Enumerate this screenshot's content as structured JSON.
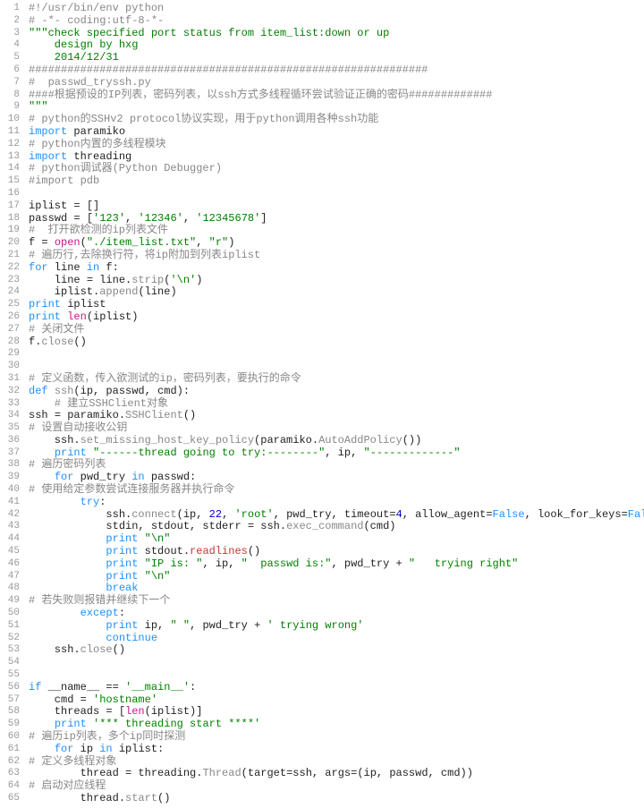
{
  "lines": [
    {
      "n": 1,
      "seg": [
        [
          "c",
          "#!/usr/bin/env python"
        ]
      ]
    },
    {
      "n": 2,
      "seg": [
        [
          "c",
          "# -*- coding:utf-8-*-"
        ]
      ]
    },
    {
      "n": 3,
      "seg": [
        [
          "s",
          "\"\"\"check specified port status from item_list:down or up"
        ]
      ]
    },
    {
      "n": 4,
      "seg": [
        [
          "s",
          "    design by hxg"
        ]
      ]
    },
    {
      "n": 5,
      "seg": [
        [
          "s",
          "    2014/12/31"
        ]
      ]
    },
    {
      "n": 6,
      "seg": [
        [
          "c",
          "##############################################################"
        ]
      ]
    },
    {
      "n": 7,
      "seg": [
        [
          "c",
          "#  passwd_tryssh.py"
        ]
      ]
    },
    {
      "n": 8,
      "seg": [
        [
          "c",
          "####根据预设的IP列表，密码列表，以ssh方式多线程循环尝试验证正确的密码#############"
        ]
      ]
    },
    {
      "n": 9,
      "seg": [
        [
          "s",
          "\"\"\""
        ]
      ]
    },
    {
      "n": 10,
      "seg": [
        [
          "c",
          "# python的SSHv2 protocol协议实现，用于python调用各种ssh功能"
        ]
      ]
    },
    {
      "n": 11,
      "seg": [
        [
          "kw",
          "import"
        ],
        [
          "nm",
          " paramiko"
        ]
      ]
    },
    {
      "n": 12,
      "seg": [
        [
          "c",
          "# python内置的多线程模块"
        ]
      ]
    },
    {
      "n": 13,
      "seg": [
        [
          "kw",
          "import"
        ],
        [
          "nm",
          " threading"
        ]
      ]
    },
    {
      "n": 14,
      "seg": [
        [
          "c",
          "# python调试器(Python Debugger)"
        ]
      ]
    },
    {
      "n": 15,
      "seg": [
        [
          "c",
          "#import pdb"
        ]
      ]
    },
    {
      "n": 16,
      "seg": [
        [
          "nm",
          ""
        ]
      ]
    },
    {
      "n": 17,
      "seg": [
        [
          "nm",
          "iplist "
        ],
        [
          "op",
          "="
        ],
        [
          "nm",
          " []"
        ]
      ]
    },
    {
      "n": 18,
      "seg": [
        [
          "nm",
          "passwd "
        ],
        [
          "op",
          "="
        ],
        [
          "nm",
          " ["
        ],
        [
          "s",
          "'123'"
        ],
        [
          "nm",
          ", "
        ],
        [
          "s",
          "'12346'"
        ],
        [
          "nm",
          ", "
        ],
        [
          "s",
          "'12345678'"
        ],
        [
          "nm",
          "]"
        ]
      ]
    },
    {
      "n": 19,
      "seg": [
        [
          "c",
          "#  打开欲检测的ip列表文件"
        ]
      ]
    },
    {
      "n": 20,
      "seg": [
        [
          "nm",
          "f "
        ],
        [
          "op",
          "="
        ],
        [
          "nm",
          " "
        ],
        [
          "bi",
          "open"
        ],
        [
          "nm",
          "("
        ],
        [
          "s",
          "\"./item_list.txt\""
        ],
        [
          "nm",
          ", "
        ],
        [
          "s",
          "\"r\""
        ],
        [
          "nm",
          ")"
        ]
      ]
    },
    {
      "n": 21,
      "seg": [
        [
          "c",
          "# 遍历行,去除换行符，将ip附加到列表iplist"
        ]
      ]
    },
    {
      "n": 22,
      "seg": [
        [
          "kw",
          "for"
        ],
        [
          "nm",
          " line "
        ],
        [
          "kw",
          "in"
        ],
        [
          "nm",
          " f:"
        ]
      ]
    },
    {
      "n": 23,
      "seg": [
        [
          "nm",
          "    line "
        ],
        [
          "op",
          "="
        ],
        [
          "nm",
          " line."
        ],
        [
          "fn",
          "strip"
        ],
        [
          "nm",
          "("
        ],
        [
          "s",
          "'\\n'"
        ],
        [
          "nm",
          ")"
        ]
      ]
    },
    {
      "n": 24,
      "seg": [
        [
          "nm",
          "    iplist."
        ],
        [
          "fn",
          "append"
        ],
        [
          "nm",
          "(line)"
        ]
      ]
    },
    {
      "n": 25,
      "seg": [
        [
          "kw",
          "print"
        ],
        [
          "nm",
          " iplist"
        ]
      ]
    },
    {
      "n": 26,
      "seg": [
        [
          "kw",
          "print"
        ],
        [
          "nm",
          " "
        ],
        [
          "bi",
          "len"
        ],
        [
          "nm",
          "(iplist)"
        ]
      ]
    },
    {
      "n": 27,
      "seg": [
        [
          "c",
          "# 关闭文件"
        ]
      ]
    },
    {
      "n": 28,
      "seg": [
        [
          "nm",
          "f."
        ],
        [
          "fn",
          "close"
        ],
        [
          "nm",
          "()"
        ]
      ]
    },
    {
      "n": 29,
      "seg": [
        [
          "nm",
          ""
        ]
      ]
    },
    {
      "n": 30,
      "seg": [
        [
          "nm",
          ""
        ]
      ]
    },
    {
      "n": 31,
      "seg": [
        [
          "c",
          "# 定义函数，传入欲测试的ip，密码列表，要执行的命令"
        ]
      ]
    },
    {
      "n": 32,
      "seg": [
        [
          "kw",
          "def"
        ],
        [
          "nm",
          " "
        ],
        [
          "fn",
          "ssh"
        ],
        [
          "nm",
          "(ip, passwd, cmd):"
        ]
      ]
    },
    {
      "n": 33,
      "seg": [
        [
          "c",
          "    # 建立SSHClient对象"
        ]
      ]
    },
    {
      "n": 34,
      "seg": [
        [
          "nm",
          "ssh "
        ],
        [
          "op",
          "="
        ],
        [
          "nm",
          " paramiko."
        ],
        [
          "fn",
          "SSHClient"
        ],
        [
          "nm",
          "()"
        ]
      ]
    },
    {
      "n": 35,
      "seg": [
        [
          "c",
          "# 设置自动接收公钥"
        ]
      ]
    },
    {
      "n": 36,
      "seg": [
        [
          "nm",
          "    ssh."
        ],
        [
          "fn",
          "set_missing_host_key_policy"
        ],
        [
          "nm",
          "(paramiko."
        ],
        [
          "fn",
          "AutoAddPolicy"
        ],
        [
          "nm",
          "())"
        ]
      ]
    },
    {
      "n": 37,
      "seg": [
        [
          "nm",
          "    "
        ],
        [
          "kw",
          "print"
        ],
        [
          "nm",
          " "
        ],
        [
          "s",
          "\"------thread going to try:--------\""
        ],
        [
          "nm",
          ", ip, "
        ],
        [
          "s",
          "\"-------------\""
        ]
      ]
    },
    {
      "n": 38,
      "seg": [
        [
          "c",
          "# 遍历密码列表"
        ]
      ]
    },
    {
      "n": 39,
      "seg": [
        [
          "nm",
          "    "
        ],
        [
          "kw",
          "for"
        ],
        [
          "nm",
          " pwd_try "
        ],
        [
          "kw",
          "in"
        ],
        [
          "nm",
          " passwd:"
        ]
      ]
    },
    {
      "n": 40,
      "seg": [
        [
          "c",
          "# 使用给定参数尝试连接服务器并执行命令"
        ]
      ]
    },
    {
      "n": 41,
      "seg": [
        [
          "nm",
          "        "
        ],
        [
          "kw",
          "try"
        ],
        [
          "nm",
          ":"
        ]
      ]
    },
    {
      "n": 42,
      "seg": [
        [
          "nm",
          "            ssh."
        ],
        [
          "fn",
          "connect"
        ],
        [
          "nm",
          "(ip, "
        ],
        [
          "nmb",
          "22"
        ],
        [
          "nm",
          ", "
        ],
        [
          "s",
          "'root'"
        ],
        [
          "nm",
          ", pwd_try, timeout"
        ],
        [
          "op",
          "="
        ],
        [
          "nmb",
          "4"
        ],
        [
          "nm",
          ", allow_agent"
        ],
        [
          "op",
          "="
        ],
        [
          "kw",
          "False"
        ],
        [
          "nm",
          ", look_for_keys"
        ],
        [
          "op",
          "="
        ],
        [
          "kw",
          "False"
        ],
        [
          "nm",
          ")"
        ]
      ]
    },
    {
      "n": 43,
      "seg": [
        [
          "nm",
          "            stdin, stdout, stderr "
        ],
        [
          "op",
          "="
        ],
        [
          "nm",
          " ssh."
        ],
        [
          "fn",
          "exec_command"
        ],
        [
          "nm",
          "(cmd)"
        ]
      ]
    },
    {
      "n": 44,
      "seg": [
        [
          "nm",
          "            "
        ],
        [
          "kw",
          "print"
        ],
        [
          "nm",
          " "
        ],
        [
          "s",
          "\"\\n\""
        ]
      ]
    },
    {
      "n": 45,
      "seg": [
        [
          "nm",
          "            "
        ],
        [
          "kw",
          "print"
        ],
        [
          "nm",
          " stdout."
        ],
        [
          "rd",
          "readlines"
        ],
        [
          "nm",
          "()"
        ]
      ]
    },
    {
      "n": 46,
      "seg": [
        [
          "nm",
          "            "
        ],
        [
          "kw",
          "print"
        ],
        [
          "nm",
          " "
        ],
        [
          "s",
          "\"IP is: \""
        ],
        [
          "nm",
          ", ip, "
        ],
        [
          "s",
          "\"  passwd is:\""
        ],
        [
          "nm",
          ", pwd_try "
        ],
        [
          "op",
          "+"
        ],
        [
          "nm",
          " "
        ],
        [
          "s",
          "\"   trying right\""
        ]
      ]
    },
    {
      "n": 47,
      "seg": [
        [
          "nm",
          "            "
        ],
        [
          "kw",
          "print"
        ],
        [
          "nm",
          " "
        ],
        [
          "s",
          "\"\\n\""
        ]
      ]
    },
    {
      "n": 48,
      "seg": [
        [
          "nm",
          "            "
        ],
        [
          "kw",
          "break"
        ]
      ]
    },
    {
      "n": 49,
      "seg": [
        [
          "c",
          "# 若失败则报错并继续下一个"
        ]
      ]
    },
    {
      "n": 50,
      "seg": [
        [
          "nm",
          "        "
        ],
        [
          "kw",
          "except"
        ],
        [
          "nm",
          ":"
        ]
      ]
    },
    {
      "n": 51,
      "seg": [
        [
          "nm",
          "            "
        ],
        [
          "kw",
          "print"
        ],
        [
          "nm",
          " ip, "
        ],
        [
          "s",
          "\" \""
        ],
        [
          "nm",
          ", pwd_try "
        ],
        [
          "op",
          "+"
        ],
        [
          "nm",
          " "
        ],
        [
          "s",
          "' trying wrong'"
        ]
      ]
    },
    {
      "n": 52,
      "seg": [
        [
          "nm",
          "            "
        ],
        [
          "kw",
          "continue"
        ]
      ]
    },
    {
      "n": 53,
      "seg": [
        [
          "nm",
          "    ssh."
        ],
        [
          "fn",
          "close"
        ],
        [
          "nm",
          "()"
        ]
      ]
    },
    {
      "n": 54,
      "seg": [
        [
          "nm",
          ""
        ]
      ]
    },
    {
      "n": 55,
      "seg": [
        [
          "nm",
          ""
        ]
      ]
    },
    {
      "n": 56,
      "seg": [
        [
          "kw",
          "if"
        ],
        [
          "nm",
          " __name__ "
        ],
        [
          "op",
          "=="
        ],
        [
          "nm",
          " "
        ],
        [
          "s",
          "'__main__'"
        ],
        [
          "nm",
          ":"
        ]
      ]
    },
    {
      "n": 57,
      "seg": [
        [
          "nm",
          "    cmd "
        ],
        [
          "op",
          "="
        ],
        [
          "nm",
          " "
        ],
        [
          "s",
          "'hostname'"
        ]
      ]
    },
    {
      "n": 58,
      "seg": [
        [
          "nm",
          "    threads "
        ],
        [
          "op",
          "="
        ],
        [
          "nm",
          " ["
        ],
        [
          "bi",
          "len"
        ],
        [
          "nm",
          "(iplist)]"
        ]
      ]
    },
    {
      "n": 59,
      "seg": [
        [
          "nm",
          "    "
        ],
        [
          "kw",
          "print"
        ],
        [
          "nm",
          " "
        ],
        [
          "s",
          "'*** threading start ****'"
        ]
      ]
    },
    {
      "n": 60,
      "seg": [
        [
          "c",
          "# 遍历ip列表，多个ip同时探测"
        ]
      ]
    },
    {
      "n": 61,
      "seg": [
        [
          "nm",
          "    "
        ],
        [
          "kw",
          "for"
        ],
        [
          "nm",
          " ip "
        ],
        [
          "kw",
          "in"
        ],
        [
          "nm",
          " iplist:"
        ]
      ]
    },
    {
      "n": 62,
      "seg": [
        [
          "c",
          "# 定义多线程对象"
        ]
      ]
    },
    {
      "n": 63,
      "seg": [
        [
          "nm",
          "        thread "
        ],
        [
          "op",
          "="
        ],
        [
          "nm",
          " threading."
        ],
        [
          "fn",
          "Thread"
        ],
        [
          "nm",
          "(target"
        ],
        [
          "op",
          "="
        ],
        [
          "nm",
          "ssh, args"
        ],
        [
          "op",
          "="
        ],
        [
          "nm",
          "(ip, passwd, cmd))"
        ]
      ]
    },
    {
      "n": 64,
      "seg": [
        [
          "c",
          "# 启动对应线程"
        ]
      ]
    },
    {
      "n": 65,
      "seg": [
        [
          "nm",
          "        thread."
        ],
        [
          "fn",
          "start"
        ],
        [
          "nm",
          "()"
        ]
      ]
    }
  ]
}
